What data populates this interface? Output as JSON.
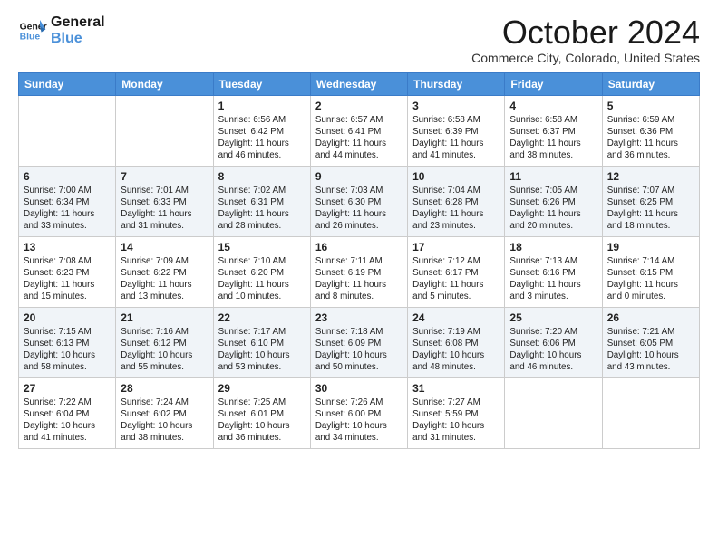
{
  "logo": {
    "line1": "General",
    "line2": "Blue"
  },
  "title": "October 2024",
  "subtitle": "Commerce City, Colorado, United States",
  "weekdays": [
    "Sunday",
    "Monday",
    "Tuesday",
    "Wednesday",
    "Thursday",
    "Friday",
    "Saturday"
  ],
  "weeks": [
    [
      {
        "day": "",
        "info": ""
      },
      {
        "day": "",
        "info": ""
      },
      {
        "day": "1",
        "info": "Sunrise: 6:56 AM\nSunset: 6:42 PM\nDaylight: 11 hours and 46 minutes."
      },
      {
        "day": "2",
        "info": "Sunrise: 6:57 AM\nSunset: 6:41 PM\nDaylight: 11 hours and 44 minutes."
      },
      {
        "day": "3",
        "info": "Sunrise: 6:58 AM\nSunset: 6:39 PM\nDaylight: 11 hours and 41 minutes."
      },
      {
        "day": "4",
        "info": "Sunrise: 6:58 AM\nSunset: 6:37 PM\nDaylight: 11 hours and 38 minutes."
      },
      {
        "day": "5",
        "info": "Sunrise: 6:59 AM\nSunset: 6:36 PM\nDaylight: 11 hours and 36 minutes."
      }
    ],
    [
      {
        "day": "6",
        "info": "Sunrise: 7:00 AM\nSunset: 6:34 PM\nDaylight: 11 hours and 33 minutes."
      },
      {
        "day": "7",
        "info": "Sunrise: 7:01 AM\nSunset: 6:33 PM\nDaylight: 11 hours and 31 minutes."
      },
      {
        "day": "8",
        "info": "Sunrise: 7:02 AM\nSunset: 6:31 PM\nDaylight: 11 hours and 28 minutes."
      },
      {
        "day": "9",
        "info": "Sunrise: 7:03 AM\nSunset: 6:30 PM\nDaylight: 11 hours and 26 minutes."
      },
      {
        "day": "10",
        "info": "Sunrise: 7:04 AM\nSunset: 6:28 PM\nDaylight: 11 hours and 23 minutes."
      },
      {
        "day": "11",
        "info": "Sunrise: 7:05 AM\nSunset: 6:26 PM\nDaylight: 11 hours and 20 minutes."
      },
      {
        "day": "12",
        "info": "Sunrise: 7:07 AM\nSunset: 6:25 PM\nDaylight: 11 hours and 18 minutes."
      }
    ],
    [
      {
        "day": "13",
        "info": "Sunrise: 7:08 AM\nSunset: 6:23 PM\nDaylight: 11 hours and 15 minutes."
      },
      {
        "day": "14",
        "info": "Sunrise: 7:09 AM\nSunset: 6:22 PM\nDaylight: 11 hours and 13 minutes."
      },
      {
        "day": "15",
        "info": "Sunrise: 7:10 AM\nSunset: 6:20 PM\nDaylight: 11 hours and 10 minutes."
      },
      {
        "day": "16",
        "info": "Sunrise: 7:11 AM\nSunset: 6:19 PM\nDaylight: 11 hours and 8 minutes."
      },
      {
        "day": "17",
        "info": "Sunrise: 7:12 AM\nSunset: 6:17 PM\nDaylight: 11 hours and 5 minutes."
      },
      {
        "day": "18",
        "info": "Sunrise: 7:13 AM\nSunset: 6:16 PM\nDaylight: 11 hours and 3 minutes."
      },
      {
        "day": "19",
        "info": "Sunrise: 7:14 AM\nSunset: 6:15 PM\nDaylight: 11 hours and 0 minutes."
      }
    ],
    [
      {
        "day": "20",
        "info": "Sunrise: 7:15 AM\nSunset: 6:13 PM\nDaylight: 10 hours and 58 minutes."
      },
      {
        "day": "21",
        "info": "Sunrise: 7:16 AM\nSunset: 6:12 PM\nDaylight: 10 hours and 55 minutes."
      },
      {
        "day": "22",
        "info": "Sunrise: 7:17 AM\nSunset: 6:10 PM\nDaylight: 10 hours and 53 minutes."
      },
      {
        "day": "23",
        "info": "Sunrise: 7:18 AM\nSunset: 6:09 PM\nDaylight: 10 hours and 50 minutes."
      },
      {
        "day": "24",
        "info": "Sunrise: 7:19 AM\nSunset: 6:08 PM\nDaylight: 10 hours and 48 minutes."
      },
      {
        "day": "25",
        "info": "Sunrise: 7:20 AM\nSunset: 6:06 PM\nDaylight: 10 hours and 46 minutes."
      },
      {
        "day": "26",
        "info": "Sunrise: 7:21 AM\nSunset: 6:05 PM\nDaylight: 10 hours and 43 minutes."
      }
    ],
    [
      {
        "day": "27",
        "info": "Sunrise: 7:22 AM\nSunset: 6:04 PM\nDaylight: 10 hours and 41 minutes."
      },
      {
        "day": "28",
        "info": "Sunrise: 7:24 AM\nSunset: 6:02 PM\nDaylight: 10 hours and 38 minutes."
      },
      {
        "day": "29",
        "info": "Sunrise: 7:25 AM\nSunset: 6:01 PM\nDaylight: 10 hours and 36 minutes."
      },
      {
        "day": "30",
        "info": "Sunrise: 7:26 AM\nSunset: 6:00 PM\nDaylight: 10 hours and 34 minutes."
      },
      {
        "day": "31",
        "info": "Sunrise: 7:27 AM\nSunset: 5:59 PM\nDaylight: 10 hours and 31 minutes."
      },
      {
        "day": "",
        "info": ""
      },
      {
        "day": "",
        "info": ""
      }
    ]
  ]
}
